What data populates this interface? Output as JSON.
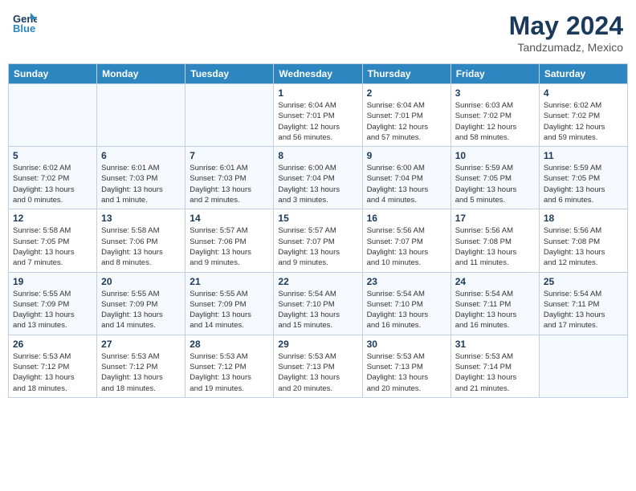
{
  "header": {
    "logo_line1": "General",
    "logo_line2": "Blue",
    "month": "May 2024",
    "location": "Tandzumadz, Mexico"
  },
  "weekdays": [
    "Sunday",
    "Monday",
    "Tuesday",
    "Wednesday",
    "Thursday",
    "Friday",
    "Saturday"
  ],
  "weeks": [
    [
      {
        "day": "",
        "info": ""
      },
      {
        "day": "",
        "info": ""
      },
      {
        "day": "",
        "info": ""
      },
      {
        "day": "1",
        "info": "Sunrise: 6:04 AM\nSunset: 7:01 PM\nDaylight: 12 hours\nand 56 minutes."
      },
      {
        "day": "2",
        "info": "Sunrise: 6:04 AM\nSunset: 7:01 PM\nDaylight: 12 hours\nand 57 minutes."
      },
      {
        "day": "3",
        "info": "Sunrise: 6:03 AM\nSunset: 7:02 PM\nDaylight: 12 hours\nand 58 minutes."
      },
      {
        "day": "4",
        "info": "Sunrise: 6:02 AM\nSunset: 7:02 PM\nDaylight: 12 hours\nand 59 minutes."
      }
    ],
    [
      {
        "day": "5",
        "info": "Sunrise: 6:02 AM\nSunset: 7:02 PM\nDaylight: 13 hours\nand 0 minutes."
      },
      {
        "day": "6",
        "info": "Sunrise: 6:01 AM\nSunset: 7:03 PM\nDaylight: 13 hours\nand 1 minute."
      },
      {
        "day": "7",
        "info": "Sunrise: 6:01 AM\nSunset: 7:03 PM\nDaylight: 13 hours\nand 2 minutes."
      },
      {
        "day": "8",
        "info": "Sunrise: 6:00 AM\nSunset: 7:04 PM\nDaylight: 13 hours\nand 3 minutes."
      },
      {
        "day": "9",
        "info": "Sunrise: 6:00 AM\nSunset: 7:04 PM\nDaylight: 13 hours\nand 4 minutes."
      },
      {
        "day": "10",
        "info": "Sunrise: 5:59 AM\nSunset: 7:05 PM\nDaylight: 13 hours\nand 5 minutes."
      },
      {
        "day": "11",
        "info": "Sunrise: 5:59 AM\nSunset: 7:05 PM\nDaylight: 13 hours\nand 6 minutes."
      }
    ],
    [
      {
        "day": "12",
        "info": "Sunrise: 5:58 AM\nSunset: 7:05 PM\nDaylight: 13 hours\nand 7 minutes."
      },
      {
        "day": "13",
        "info": "Sunrise: 5:58 AM\nSunset: 7:06 PM\nDaylight: 13 hours\nand 8 minutes."
      },
      {
        "day": "14",
        "info": "Sunrise: 5:57 AM\nSunset: 7:06 PM\nDaylight: 13 hours\nand 9 minutes."
      },
      {
        "day": "15",
        "info": "Sunrise: 5:57 AM\nSunset: 7:07 PM\nDaylight: 13 hours\nand 9 minutes."
      },
      {
        "day": "16",
        "info": "Sunrise: 5:56 AM\nSunset: 7:07 PM\nDaylight: 13 hours\nand 10 minutes."
      },
      {
        "day": "17",
        "info": "Sunrise: 5:56 AM\nSunset: 7:08 PM\nDaylight: 13 hours\nand 11 minutes."
      },
      {
        "day": "18",
        "info": "Sunrise: 5:56 AM\nSunset: 7:08 PM\nDaylight: 13 hours\nand 12 minutes."
      }
    ],
    [
      {
        "day": "19",
        "info": "Sunrise: 5:55 AM\nSunset: 7:09 PM\nDaylight: 13 hours\nand 13 minutes."
      },
      {
        "day": "20",
        "info": "Sunrise: 5:55 AM\nSunset: 7:09 PM\nDaylight: 13 hours\nand 14 minutes."
      },
      {
        "day": "21",
        "info": "Sunrise: 5:55 AM\nSunset: 7:09 PM\nDaylight: 13 hours\nand 14 minutes."
      },
      {
        "day": "22",
        "info": "Sunrise: 5:54 AM\nSunset: 7:10 PM\nDaylight: 13 hours\nand 15 minutes."
      },
      {
        "day": "23",
        "info": "Sunrise: 5:54 AM\nSunset: 7:10 PM\nDaylight: 13 hours\nand 16 minutes."
      },
      {
        "day": "24",
        "info": "Sunrise: 5:54 AM\nSunset: 7:11 PM\nDaylight: 13 hours\nand 16 minutes."
      },
      {
        "day": "25",
        "info": "Sunrise: 5:54 AM\nSunset: 7:11 PM\nDaylight: 13 hours\nand 17 minutes."
      }
    ],
    [
      {
        "day": "26",
        "info": "Sunrise: 5:53 AM\nSunset: 7:12 PM\nDaylight: 13 hours\nand 18 minutes."
      },
      {
        "day": "27",
        "info": "Sunrise: 5:53 AM\nSunset: 7:12 PM\nDaylight: 13 hours\nand 18 minutes."
      },
      {
        "day": "28",
        "info": "Sunrise: 5:53 AM\nSunset: 7:12 PM\nDaylight: 13 hours\nand 19 minutes."
      },
      {
        "day": "29",
        "info": "Sunrise: 5:53 AM\nSunset: 7:13 PM\nDaylight: 13 hours\nand 20 minutes."
      },
      {
        "day": "30",
        "info": "Sunrise: 5:53 AM\nSunset: 7:13 PM\nDaylight: 13 hours\nand 20 minutes."
      },
      {
        "day": "31",
        "info": "Sunrise: 5:53 AM\nSunset: 7:14 PM\nDaylight: 13 hours\nand 21 minutes."
      },
      {
        "day": "",
        "info": ""
      }
    ]
  ]
}
